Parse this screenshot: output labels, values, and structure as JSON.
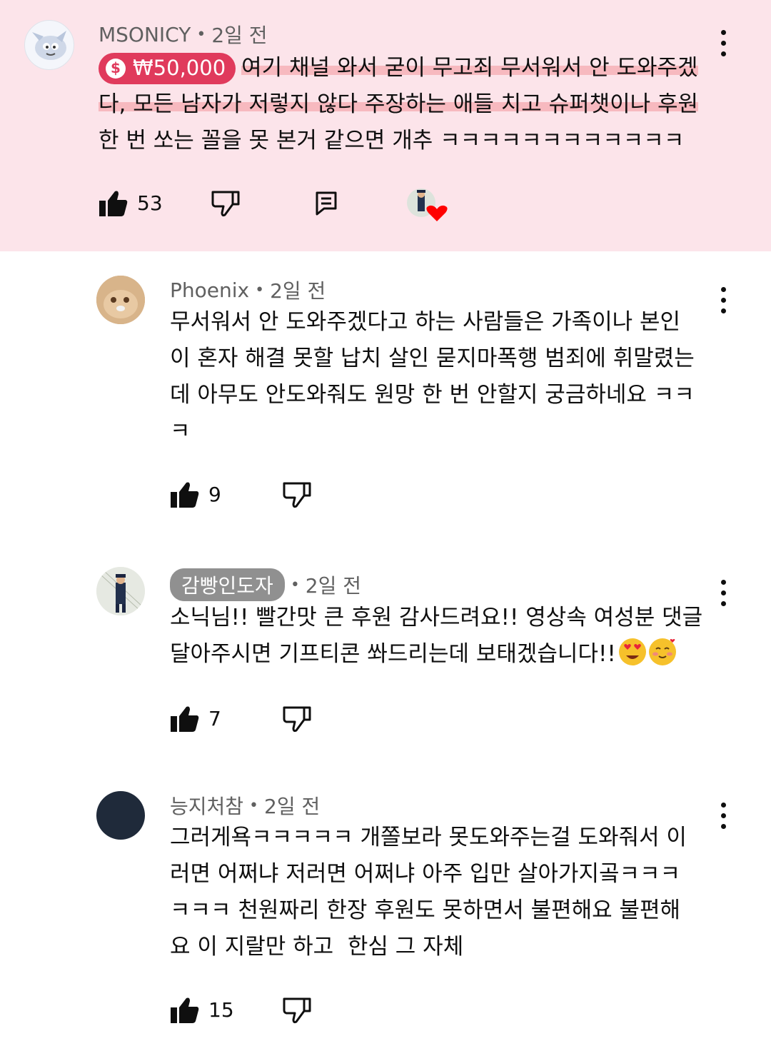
{
  "comments": [
    {
      "author": "MSONICY",
      "time": "2일 전",
      "superchat": "₩50,000",
      "lines": [
        "여기 채널 와서 굳이 무고죄 무서워서 안 도와주겠",
        "다, 모든 남자가 저렇지 않다 주장하는 애들 치고 슈퍼챗이나 후원",
        "한 번 쏘는 꼴을 못 본거 같으면 개추 ㅋㅋㅋㅋㅋㅋㅋㅋㅋㅋㅋㅋ"
      ],
      "likes": "53"
    },
    {
      "author": "Phoenix",
      "time": "2일 전",
      "lines": [
        "무서워서 안 도와주겠다고 하는 사람들은 가족이나 본인",
        "이 혼자 해결 못할 납치 살인 묻지마폭행 범죄에 휘말렸는",
        "데 아무도 안도와줘도 원망 한 번 안할지 궁금하네요 ㅋㅋ",
        "ㅋ"
      ],
      "likes": "9"
    },
    {
      "author": "감빵인도자",
      "time": "2일 전",
      "lines": [
        "소닉님!! 빨간맛 큰 후원 감사드려요!! 영상속 여성분 댓글",
        "달아주시면 기프티콘 쏴드리는데 보태겠습니다!!"
      ],
      "likes": "7"
    },
    {
      "author": "능지처참",
      "time": "2일 전",
      "lines": [
        "그러게욕ㅋㅋㅋㅋㅋ 개쫄보라 못도와주는걸 도와줘서 이",
        "러면 어쩌냐 저러면 어쩌냐 아주 입만 살아가지곸ㅋㅋㅋ",
        "ㅋㅋㅋ 천원짜리 한장 후원도 못하면서 불편해요 불편해",
        "요 이 지랄만 하고  한심 그 자체"
      ],
      "likes": "15"
    }
  ],
  "colors": {
    "highlight_bg": "#fce4ea",
    "superchat": "#e03a5c",
    "heart": "#ff0000"
  },
  "icons": [
    "like-icon",
    "dislike-icon",
    "reply-icon",
    "creator-heart-icon",
    "more-options-icon"
  ]
}
